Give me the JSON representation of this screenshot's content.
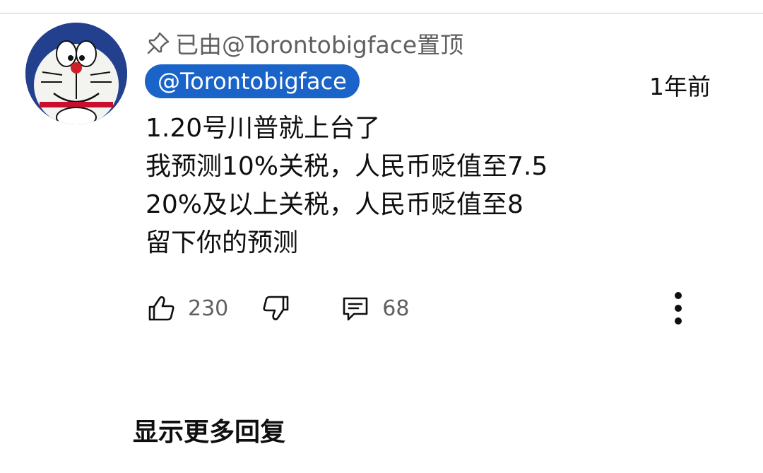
{
  "comment": {
    "pinned_text": "已由@Torontobigface置顶",
    "author": "@Torontobigface",
    "timestamp": "1年前",
    "body_lines": [
      "1.20号川普就上台了",
      "我预测10%关税，人民币贬值至7.5",
      "20%及以上关税，人民币贬值至8",
      "留下你的预测"
    ],
    "likes": "230",
    "replies": "68"
  },
  "show_more_replies": "显示更多回复",
  "icons": {
    "pin": "pin-icon",
    "like": "thumbs-up-icon",
    "dislike": "thumbs-down-icon",
    "reply": "comment-icon",
    "more": "more-vertical-icon"
  },
  "colors": {
    "author_chip": "#1a63c9",
    "secondary_text": "#606060"
  }
}
